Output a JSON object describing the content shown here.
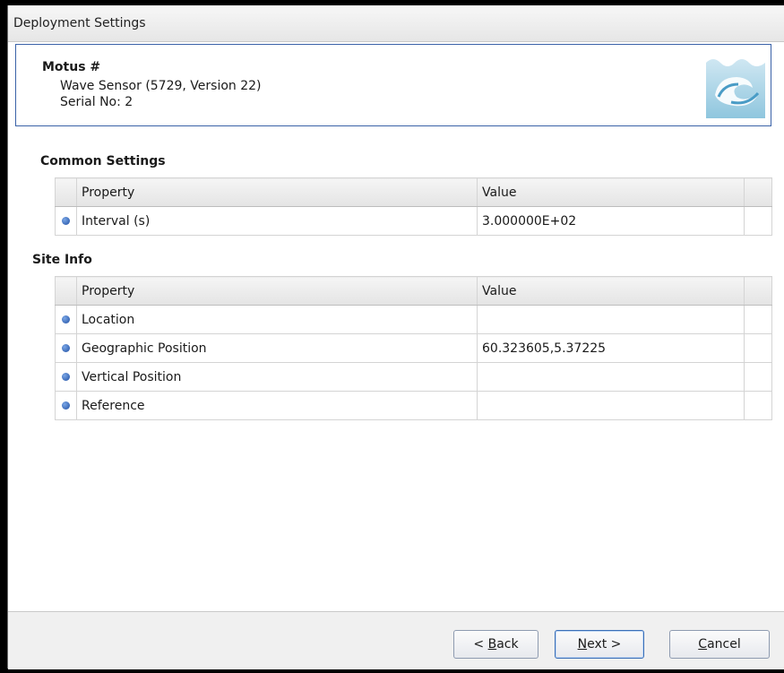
{
  "window": {
    "title": "Deployment Settings"
  },
  "header": {
    "device_label": "Motus #",
    "sensor_line": "Wave Sensor (5729, Version 22)",
    "serial_line": "Serial No: 2",
    "logo_icon": "wave-logo-icon"
  },
  "common_settings": {
    "title": "Common Settings",
    "columns": [
      "Property",
      "Value"
    ],
    "rows": [
      {
        "property": "Interval (s)",
        "value": "3.000000E+02"
      }
    ]
  },
  "site_info": {
    "title": "Site Info",
    "columns": [
      "Property",
      "Value"
    ],
    "rows": [
      {
        "property": "Location",
        "value": ""
      },
      {
        "property": "Geographic Position",
        "value": "60.323605,5.37225"
      },
      {
        "property": "Vertical Position",
        "value": ""
      },
      {
        "property": "Reference",
        "value": ""
      }
    ]
  },
  "buttons": {
    "back": {
      "prefix": "< ",
      "key": "B",
      "rest": "ack"
    },
    "next": {
      "key": "N",
      "rest": "ext >"
    },
    "cancel": {
      "key": "C",
      "rest": "ancel"
    }
  },
  "colors": {
    "header_border": "#3a62a8",
    "indicator": "#1f4fa3",
    "outer_background": "#000000"
  }
}
